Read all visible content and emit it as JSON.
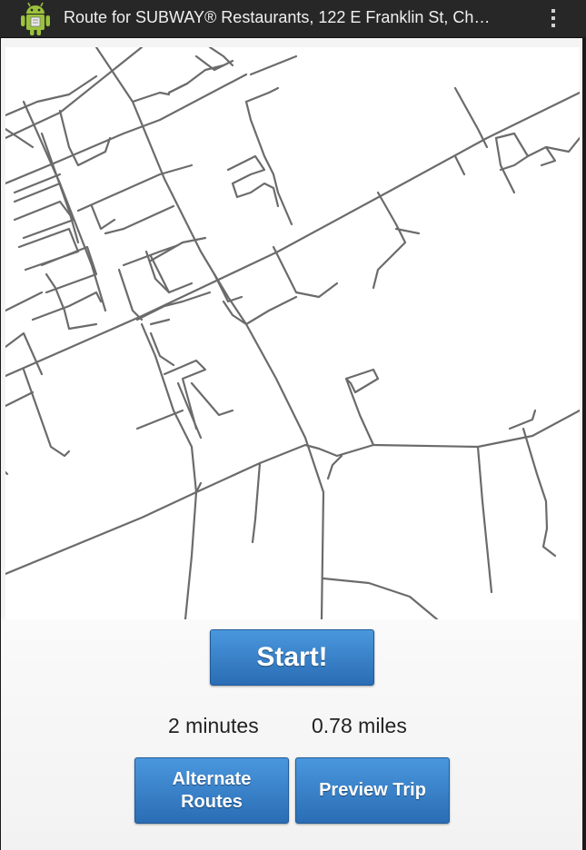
{
  "action_bar": {
    "title": "Route for SUBWAY® Restaurants, 122 E Franklin St, Ch…",
    "app_icon": "android-robot-icon",
    "menu_icon": "overflow-menu-icon",
    "background": "#272727"
  },
  "map": {
    "background": "#ffffff",
    "road_color": "#6b6b6b"
  },
  "route": {
    "start_label": "Start!",
    "duration": "2 minutes",
    "distance": "0.78 miles"
  },
  "buttons": {
    "alternate_routes_line1": "Alternate",
    "alternate_routes_line2": "Routes",
    "preview_trip": "Preview Trip",
    "color_top": "#4a97dd",
    "color_bottom": "#2a6db5"
  }
}
